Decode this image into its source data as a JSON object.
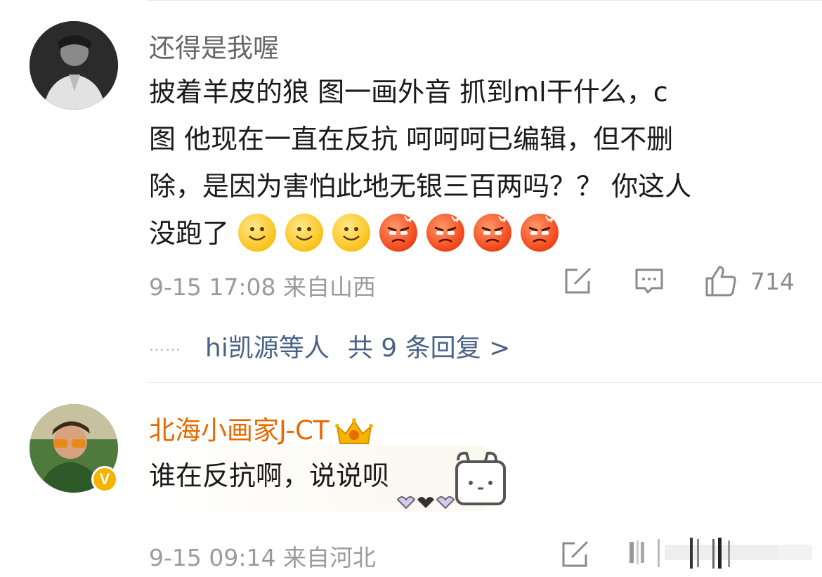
{
  "comments": [
    {
      "username": "还得是我喔",
      "lines": [
        "披着羊皮的狼  图一画外音  抓到ml干什么，c",
        "图 他现在一直在反抗  呵呵呵已编辑，但不删",
        "除，是因为害怕此地无银三百两吗？？  你这人",
        "没跑了"
      ],
      "emojis": [
        "smile",
        "smile",
        "smile",
        "angry",
        "angry",
        "angry",
        "angry"
      ],
      "date": "9-15 17:08",
      "location": "来自山西",
      "like_count": "714",
      "replies": {
        "dots": "……",
        "users": "hi凯源等人",
        "count": "共 9 条回复 >"
      }
    },
    {
      "username": "北海小画家J-CT",
      "verified": true,
      "text": "谁在反抗啊，说说呗",
      "date": "9-15 09:14",
      "location": "来自河北"
    }
  ],
  "colors": {
    "username_gray": "#666666",
    "username_vip": "#e86a00",
    "link_blue": "#4a6285",
    "meta_gray": "#9b9b9b"
  }
}
